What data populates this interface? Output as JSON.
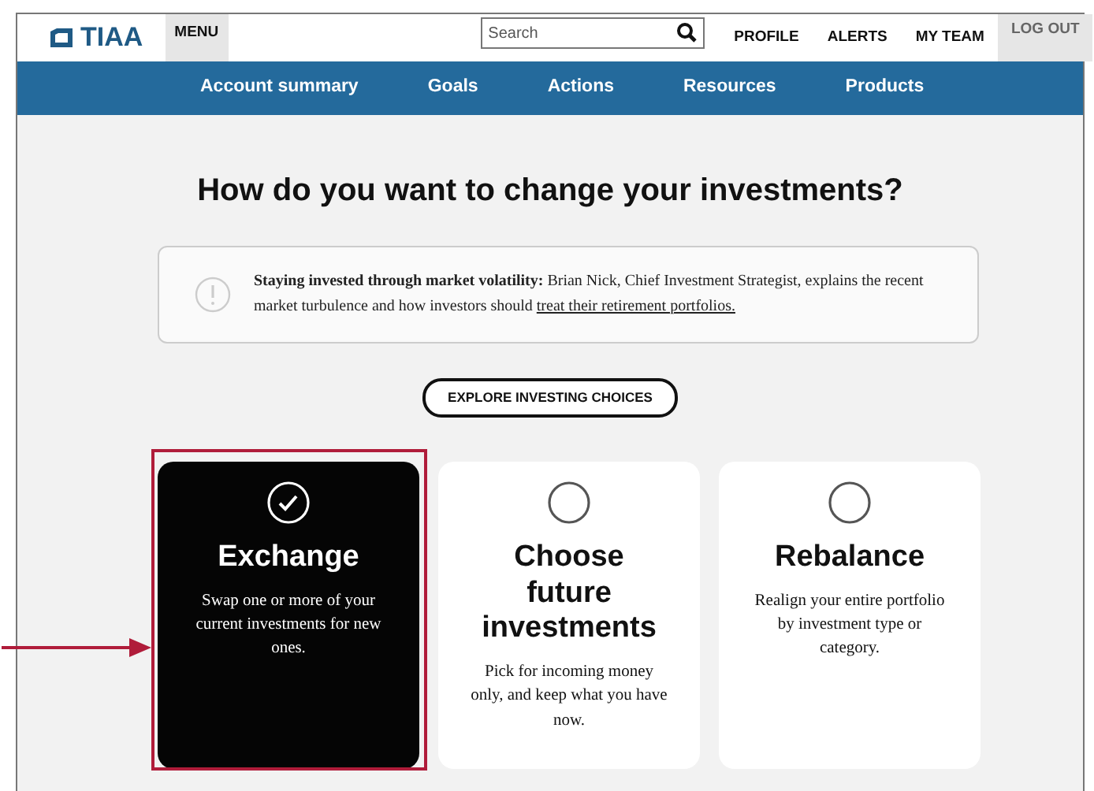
{
  "header": {
    "logo": "TIAA",
    "menu": "MENU",
    "search": {
      "placeholder": "Search"
    },
    "links": [
      "PROFILE",
      "ALERTS",
      "MY TEAM"
    ],
    "logout": "LOG OUT"
  },
  "nav": [
    "Account summary",
    "Goals",
    "Actions",
    "Resources",
    "Products"
  ],
  "heading": "How do you want to change your investments?",
  "notice": {
    "lead": "Staying invested through market volatility:",
    "text": " Brian Nick, Chief Investment Strategist, explains the recent market turbulence and how investors should ",
    "link": "treat their retirement portfolios."
  },
  "explore_button": "EXPLORE INVESTING CHOICES",
  "options": [
    {
      "title": "Exchange",
      "description": "Swap one or more of your current investments for new ones.",
      "selected": true
    },
    {
      "title": "Choose future investments",
      "description": "Pick for incoming money only, and keep what you have now.",
      "selected": false
    },
    {
      "title": "Rebalance",
      "description": "Realign your entire portfolio by investment type or category.",
      "selected": false
    }
  ]
}
